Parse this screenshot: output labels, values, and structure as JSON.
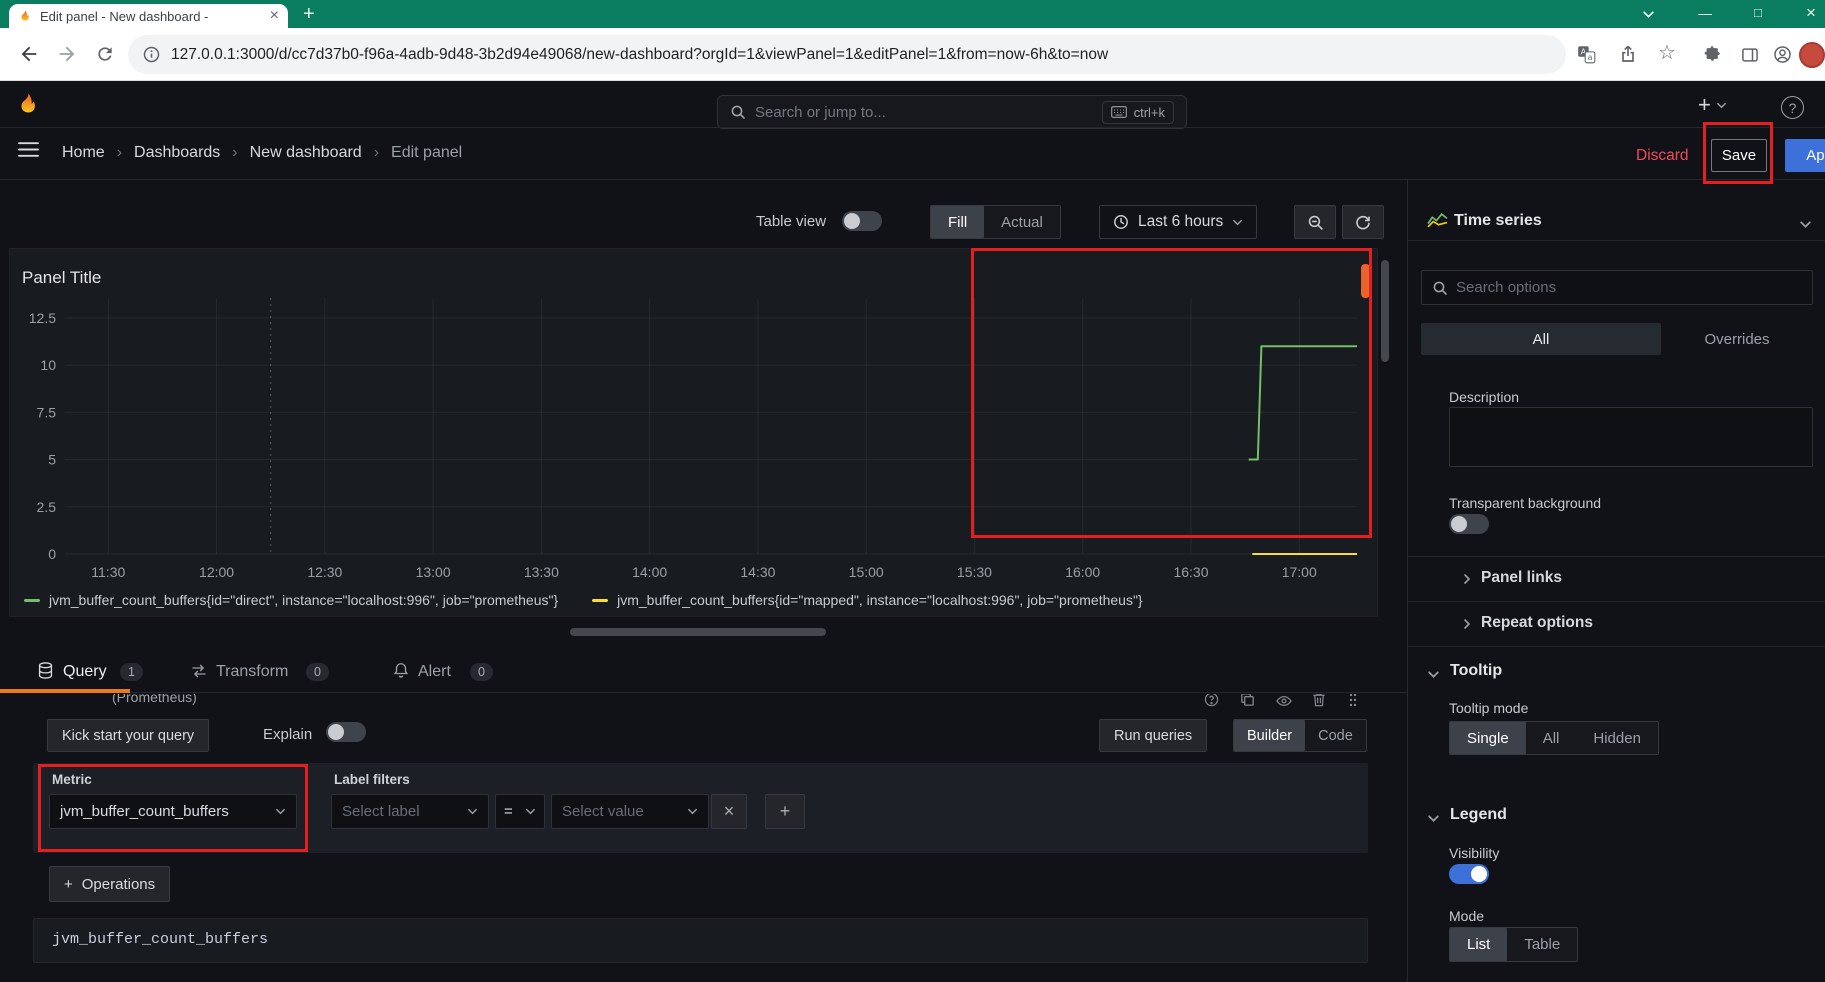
{
  "glyphs": {
    "close": "×",
    "plus": "+",
    "minimize": "—",
    "maximize": "□",
    "star": "☆",
    "question": "?",
    "crumb_sep": "›"
  },
  "colors": {
    "accent_orange": "#eb7b18",
    "primary_blue": "#3d71d9",
    "destructive_red": "#f2495c",
    "annotation_red": "#e51f1f",
    "series_green": "#73bf69",
    "series_yellow": "#fade2a"
  },
  "browser": {
    "tab_title": "Edit panel - New dashboard -",
    "url": "127.0.0.1:3000/d/cc7d37b0-f96a-4adb-9d48-3b2d94e49068/new-dashboard?orgId=1&viewPanel=1&editPanel=1&from=now-6h&to=now"
  },
  "nav": {
    "search_placeholder": "Search or jump to...",
    "shortcut": "ctrl+k"
  },
  "breadcrumb": {
    "items": [
      "Home",
      "Dashboards",
      "New dashboard",
      "Edit panel"
    ],
    "discard_label": "Discard",
    "save_label": "Save",
    "apply_label": "Apply"
  },
  "toolbar": {
    "table_view_label": "Table view",
    "fill_label": "Fill",
    "actual_label": "Actual",
    "time_range_label": "Last 6 hours"
  },
  "panel": {
    "title": "Panel Title"
  },
  "chart_data": {
    "type": "line",
    "title": "Panel Title",
    "x_ticks": [
      {
        "label": "11:30",
        "t": 0
      },
      {
        "label": "12:00",
        "t": 30
      },
      {
        "label": "12:30",
        "t": 60
      },
      {
        "label": "13:00",
        "t": 90
      },
      {
        "label": "13:30",
        "t": 120
      },
      {
        "label": "14:00",
        "t": 150
      },
      {
        "label": "14:30",
        "t": 180
      },
      {
        "label": "15:00",
        "t": 210
      },
      {
        "label": "15:30",
        "t": 240
      },
      {
        "label": "16:00",
        "t": 270
      },
      {
        "label": "16:30",
        "t": 300
      },
      {
        "label": "17:00",
        "t": 330
      }
    ],
    "x_domain": [
      -12,
      346
    ],
    "y_ticks": [
      0,
      2.5,
      5,
      7.5,
      10,
      12.5
    ],
    "y_domain": [
      0,
      13.55
    ],
    "grid": true,
    "legend_position": "bottom-left",
    "annotations": [
      {
        "type": "vline",
        "t": 45,
        "style": "dotted"
      }
    ],
    "series": [
      {
        "name": "jvm_buffer_count_buffers{id=\"direct\", instance=\"localhost:996\", job=\"prometheus\"}",
        "color": "#73bf69",
        "points": [
          {
            "t": 316,
            "y": 5
          },
          {
            "t": 318.5,
            "y": 5
          },
          {
            "t": 319.5,
            "y": 11
          },
          {
            "t": 346,
            "y": 11
          }
        ]
      },
      {
        "name": "jvm_buffer_count_buffers{id=\"mapped\", instance=\"localhost:996\", job=\"prometheus\"}",
        "color": "#fade2a",
        "points": [
          {
            "t": 317,
            "y": 0
          },
          {
            "t": 346,
            "y": 0
          }
        ]
      }
    ]
  },
  "query_editor": {
    "tabs": [
      {
        "label": "Query",
        "count": "1"
      },
      {
        "label": "Transform",
        "count": "0"
      },
      {
        "label": "Alert",
        "count": "0"
      }
    ],
    "datasource_partial": "(Prometheus)",
    "kick_start_label": "Kick start your query",
    "explain_label": "Explain",
    "run_queries_label": "Run queries",
    "builder_label": "Builder",
    "code_label": "Code",
    "metric": {
      "label": "Metric",
      "value": "jvm_buffer_count_buffers"
    },
    "label_filters": {
      "label": "Label filters",
      "select_label_placeholder": "Select label",
      "operator": "=",
      "select_value_placeholder": "Select value"
    },
    "operations_label": "Operations",
    "raw_query": "jvm_buffer_count_buffers"
  },
  "options": {
    "panel_type": "Time series",
    "search_placeholder": "Search options",
    "tabs": {
      "all": "All",
      "overrides": "Overrides"
    },
    "description_label": "Description",
    "transparent_label": "Transparent background",
    "panel_links_label": "Panel links",
    "repeat_label": "Repeat options",
    "tooltip": {
      "title": "Tooltip",
      "mode_label": "Tooltip mode",
      "modes": [
        "Single",
        "All",
        "Hidden"
      ],
      "active_mode": "Single"
    },
    "legend": {
      "title": "Legend",
      "visibility_label": "Visibility",
      "mode_label": "Mode",
      "modes": [
        "List",
        "Table"
      ],
      "active_mode": "List"
    }
  }
}
